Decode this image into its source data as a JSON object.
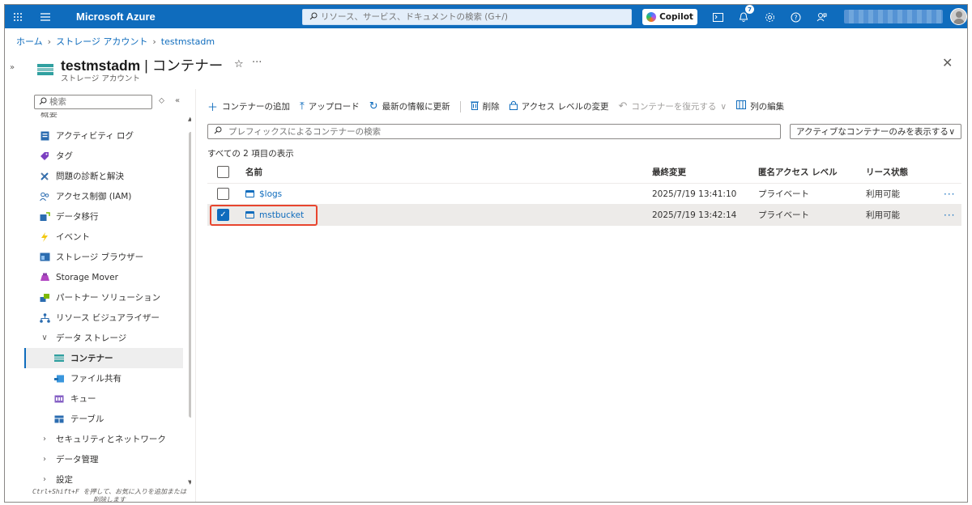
{
  "topbar": {
    "brand": "Microsoft Azure",
    "search_placeholder": "リソース、サービス、ドキュメントの検索 (G+/)",
    "copilot_label": "Copilot",
    "notification_count": "7"
  },
  "breadcrumb": [
    "ホーム",
    "ストレージ アカウント",
    "testmstadm"
  ],
  "header": {
    "resource_name": "testmstadm",
    "pipe": "|",
    "section": "コンテナー",
    "subtitle": "ストレージ アカウント"
  },
  "sidebar": {
    "search_placeholder": "検索",
    "cut_item": "概要",
    "items": [
      {
        "label": "アクティビティ ログ",
        "icon": "activity-log-icon"
      },
      {
        "label": "タグ",
        "icon": "tag-icon"
      },
      {
        "label": "問題の診断と解決",
        "icon": "wrench-icon"
      },
      {
        "label": "アクセス制御 (IAM)",
        "icon": "people-icon"
      },
      {
        "label": "データ移行",
        "icon": "migration-icon"
      },
      {
        "label": "イベント",
        "icon": "lightning-icon"
      },
      {
        "label": "ストレージ ブラウザー",
        "icon": "storage-browser-icon"
      },
      {
        "label": "Storage Mover",
        "icon": "storage-mover-icon"
      },
      {
        "label": "パートナー ソリューション",
        "icon": "partner-icon"
      },
      {
        "label": "リソース ビジュアライザー",
        "icon": "visualizer-icon"
      }
    ],
    "group_data_storage": "データ ストレージ",
    "sub_items": [
      {
        "label": "コンテナー",
        "icon": "container-icon"
      },
      {
        "label": "ファイル共有",
        "icon": "file-share-icon"
      },
      {
        "label": "キュー",
        "icon": "queue-icon"
      },
      {
        "label": "テーブル",
        "icon": "table-icon"
      }
    ],
    "groups_collapsed": [
      "セキュリティとネットワーク",
      "データ管理",
      "設定"
    ],
    "hint": "Ctrl+Shift+F を押して、お気に入りを追加または削除します"
  },
  "toolbar": {
    "add_container": "コンテナーの追加",
    "upload": "アップロード",
    "refresh": "最新の情報に更新",
    "delete": "削除",
    "change_access_level": "アクセス レベルの変更",
    "restore_containers": "コンテナーを復元する",
    "edit_columns": "列の編集"
  },
  "filters": {
    "prefix_placeholder": "プレフィックスによるコンテナーの検索",
    "active_filter": "アクティブなコンテナーのみを表示する"
  },
  "count_text": "すべての 2 項目の表示",
  "table": {
    "columns": [
      "名前",
      "最終変更",
      "匿名アクセス レベル",
      "リース状態"
    ],
    "rows": [
      {
        "name": "$logs",
        "modified": "2025/7/19 13:41:10",
        "access": "プライベート",
        "lease": "利用可能",
        "selected": false
      },
      {
        "name": "mstbucket",
        "modified": "2025/7/19 13:42:14",
        "access": "プライベート",
        "lease": "利用可能",
        "selected": true
      }
    ]
  },
  "colors": {
    "accent": "#0f6cbd",
    "highlight": "#e8452e"
  }
}
